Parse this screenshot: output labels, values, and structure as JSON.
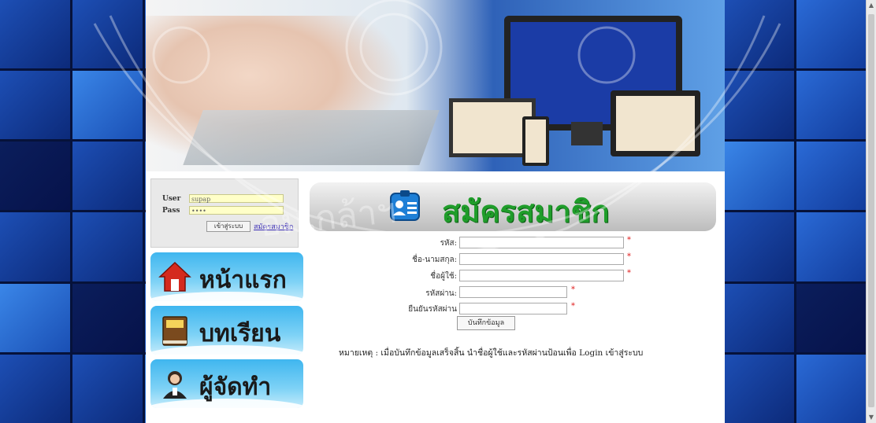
{
  "login": {
    "user_label": "User",
    "user_value": "supap",
    "pass_label": "Pass",
    "pass_value": "••••",
    "login_button": "เข้าสู่ระบบ",
    "register_link": "สมัครสมาชิก"
  },
  "nav": {
    "items": [
      {
        "label": "หน้าแรก",
        "icon": "home-icon"
      },
      {
        "label": "บทเรียน",
        "icon": "book-icon"
      },
      {
        "label": "ผู้จัดทำ",
        "icon": "person-icon"
      }
    ]
  },
  "header": {
    "title": "สมัครสมาชิก",
    "icon": "id-card-icon",
    "accent": "#1f9d2a"
  },
  "form": {
    "fields": [
      {
        "label": "รหัส:",
        "value": "",
        "required": "*"
      },
      {
        "label": "ชื่อ-นามสกุล:",
        "value": "",
        "required": "*"
      },
      {
        "label": "ชื่อผู้ใช้:",
        "value": "",
        "required": "*"
      },
      {
        "label": "รหัสผ่าน:",
        "value": "",
        "required": "*"
      },
      {
        "label": "ยืนยันรหัสผ่าน",
        "value": "",
        "required": "*"
      }
    ],
    "save_button": "บันทึกข้อมูล",
    "note": "หมายเหตุ : เมื่อบันทึกข้อมูลเสร็จสิ้น นำชื่อผู้ใช้และรหัสผ่านป้อนเพื่อ Login เข้าสู่ระบบ"
  },
  "watermark": {
    "text": "อมเกล้าฯ"
  }
}
